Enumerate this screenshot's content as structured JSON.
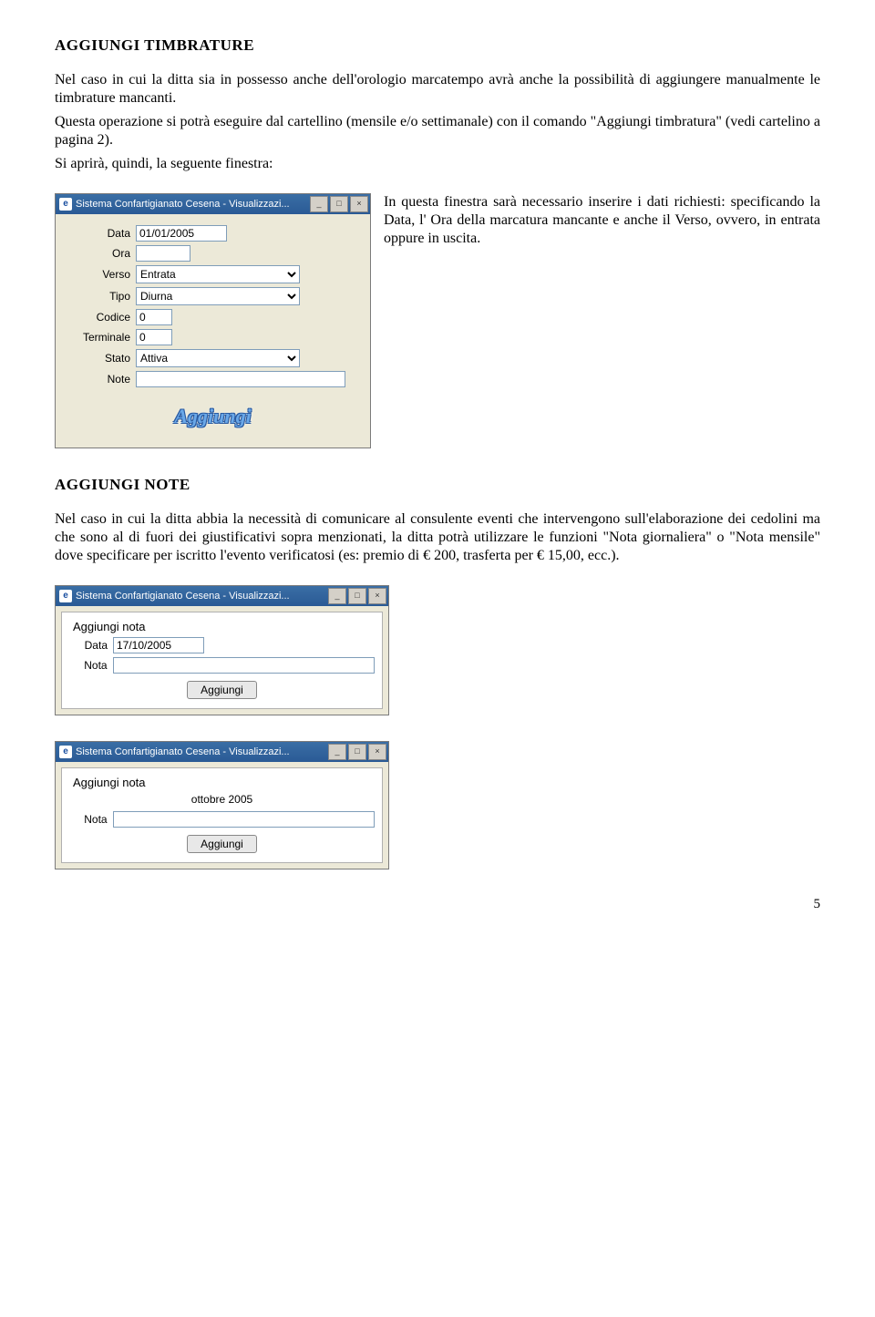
{
  "section1": {
    "heading": "AGGIUNGI  TIMBRATURE",
    "para1": "Nel caso in cui la ditta sia in possesso anche dell'orologio marcatempo avrà anche la possibilità di aggiungere manualmente le timbrature mancanti.",
    "para2": "Questa operazione si potrà eseguire dal cartellino (mensile e/o settimanale) con il comando \"Aggiungi timbratura\" (vedi cartelino a pagina 2).",
    "para3": "Si aprirà, quindi, la seguente finestra:",
    "side_text": "In questa finestra sarà necessario inserire i dati richiesti: specificando la Data, l' Ora della marcatura mancante e anche il Verso, ovvero, in entrata oppure in uscita."
  },
  "dialog1": {
    "title": "Sistema Confartigianato Cesena - Visualizzazi...",
    "labels": {
      "data": "Data",
      "ora": "Ora",
      "verso": "Verso",
      "tipo": "Tipo",
      "codice": "Codice",
      "terminale": "Terminale",
      "stato": "Stato",
      "note": "Note"
    },
    "values": {
      "data": "01/01/2005",
      "ora": "",
      "verso": "Entrata",
      "tipo": "Diurna",
      "codice": "0",
      "terminale": "0",
      "stato": "Attiva",
      "note": ""
    },
    "button": "Aggiungi"
  },
  "section2": {
    "heading": "AGGIUNGI NOTE",
    "para1": "Nel caso in cui la ditta abbia la necessità di comunicare al consulente eventi che intervengono sull'elaborazione dei cedolini ma che sono al di fuori dei giustificativi sopra menzionati, la ditta potrà utilizzare le funzioni \"Nota giornaliera\" o \"Nota mensile\" dove specificare per iscritto l'evento verificatosi (es: premio di € 200, trasferta per € 15,00, ecc.)."
  },
  "dialog2": {
    "title": "Sistema Confartigianato Cesena - Visualizzazi...",
    "heading": "Aggiungi nota",
    "labels": {
      "data": "Data",
      "nota": "Nota"
    },
    "values": {
      "data": "17/10/2005",
      "nota": ""
    },
    "button": "Aggiungi"
  },
  "dialog3": {
    "title": "Sistema Confartigianato Cesena - Visualizzazi...",
    "heading": "Aggiungi nota",
    "month": "ottobre 2005",
    "labels": {
      "nota": "Nota"
    },
    "values": {
      "nota": ""
    },
    "button": "Aggiungi"
  },
  "win_buttons": {
    "min": "_",
    "max": "□",
    "close": "×"
  },
  "page_number": "5"
}
